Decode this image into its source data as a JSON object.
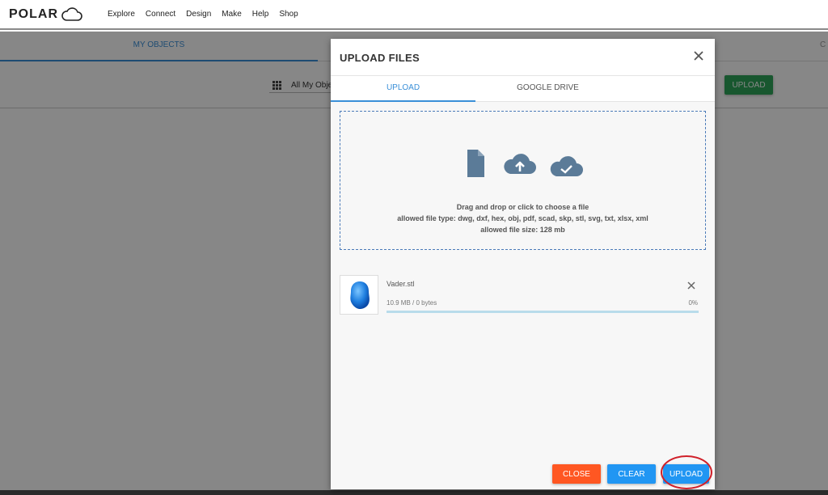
{
  "brand": {
    "logo_text": "POLAR"
  },
  "nav": {
    "items": [
      "Explore",
      "Connect",
      "Design",
      "Make",
      "Help",
      "Shop"
    ]
  },
  "page": {
    "tab_active": "MY OBJECTS",
    "tab_right": "C",
    "filter_label": "All My Obje",
    "upload_label": "UPLOAD"
  },
  "modal": {
    "title": "UPLOAD FILES",
    "tabs": [
      "UPLOAD",
      "GOOGLE DRIVE"
    ],
    "dropzone": {
      "line1": "Drag and drop or click to choose a file",
      "line2": "allowed file type: dwg, dxf, hex, obj, pdf, scad, skp, stl, svg, txt, xlsx, xml",
      "line3": "allowed file size: 128 mb"
    },
    "file": {
      "name": "Vader.stl",
      "size": "10.9 MB / 0 bytes",
      "percent": "0%",
      "progress_fraction": 0
    },
    "buttons": {
      "close": "CLOSE",
      "clear": "CLEAR",
      "upload": "UPLOAD"
    }
  },
  "colors": {
    "accent": "#3a8fd8",
    "close_button": "#ff5722",
    "action_button": "#2196f3",
    "page_upload_button": "#2ea55a",
    "annotation_circle": "#d0202a"
  },
  "icons": [
    "cloud-logo-icon",
    "grid-icon",
    "close-icon",
    "file-icon",
    "cloud-upload-icon",
    "cloud-check-icon",
    "remove-file-icon",
    "file-thumbnail-icon"
  ]
}
